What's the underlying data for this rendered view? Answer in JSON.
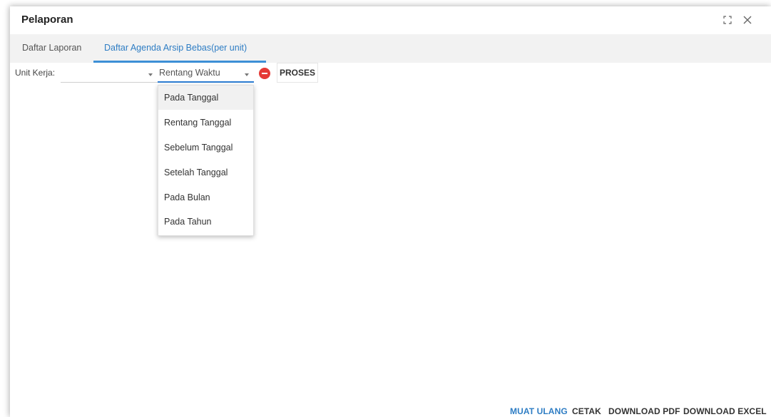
{
  "window": {
    "title": "Pelaporan",
    "controls": [
      {
        "name": "maximize",
        "icon": "expand-corners-icon"
      },
      {
        "name": "close",
        "icon": "close-icon"
      }
    ]
  },
  "tabs": [
    {
      "label": "Daftar Laporan",
      "active": false
    },
    {
      "label": "Daftar Agenda Arsip Bebas(per unit)",
      "active": true
    }
  ],
  "filters": {
    "unit_label": "Unit Kerja:",
    "unit_value": "",
    "range_value": "Rentang Waktu",
    "range_options": [
      {
        "label": "Pada Tanggal",
        "highlighted": true
      },
      {
        "label": "Rentang Tanggal",
        "highlighted": false
      },
      {
        "label": "Sebelum Tanggal",
        "highlighted": false
      },
      {
        "label": "Setelah Tanggal",
        "highlighted": false
      },
      {
        "label": "Pada Bulan",
        "highlighted": false
      },
      {
        "label": "Pada Tahun",
        "highlighted": false
      }
    ],
    "clear_icon": "remove-circle-icon",
    "process_label": "PROSES"
  },
  "footer": {
    "reload": "MUAT ULANG",
    "print": "CETAK",
    "pdf": "DOWNLOAD PDF",
    "excel": "DOWNLOAD EXCEL"
  },
  "colors": {
    "accent": "#2e7dc4",
    "danger": "#e53935",
    "tab_background": "#f2f2f2"
  }
}
